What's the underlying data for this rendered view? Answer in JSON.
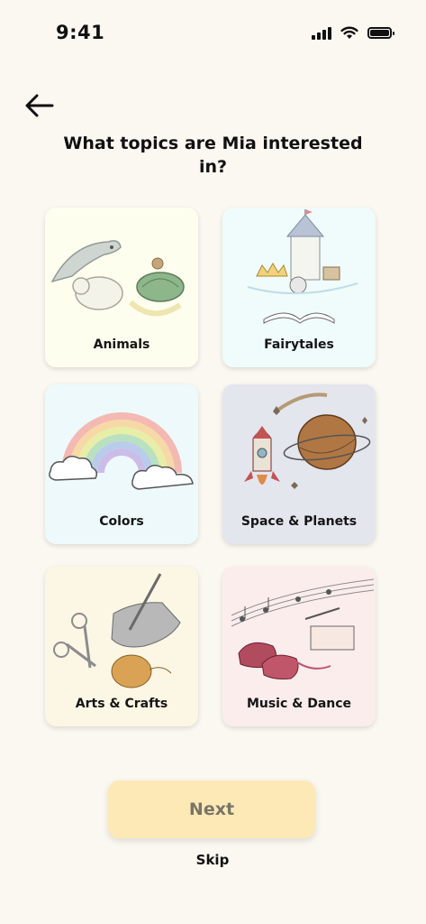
{
  "status_bar": {
    "time": "9:41"
  },
  "header": {
    "title": "What topics are Mia interested in?"
  },
  "topics": [
    {
      "label": "Animals",
      "bg": "#FEFEEE"
    },
    {
      "label": "Fairytales",
      "bg": "#F0FBFB"
    },
    {
      "label": "Colors",
      "bg": "#EEF9FC"
    },
    {
      "label": "Space & Planets",
      "bg": "#E4E6EE"
    },
    {
      "label": "Arts & Crafts",
      "bg": "#FCF6E4"
    },
    {
      "label": "Music & Dance",
      "bg": "#FCEDED"
    }
  ],
  "actions": {
    "next_label": "Next",
    "skip_label": "Skip"
  },
  "colors": {
    "background": "#FBF8F2",
    "next_button": "#FCE9B6",
    "text": "#111111"
  }
}
